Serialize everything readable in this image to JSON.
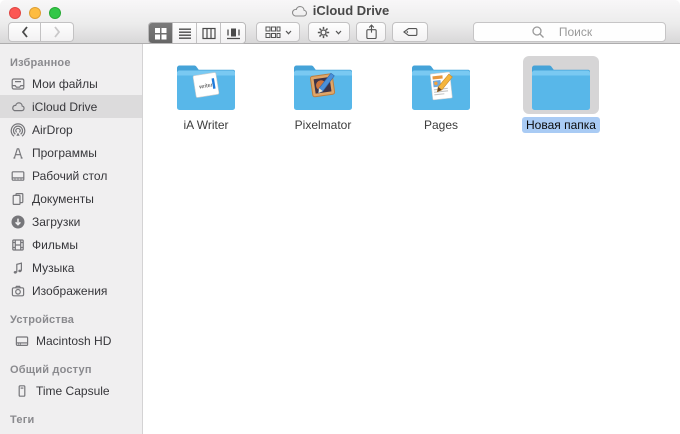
{
  "window": {
    "title": "iCloud Drive"
  },
  "toolbar": {
    "search_placeholder": "Поиск",
    "buttons": {
      "back": "back-button",
      "forward": "forward-button",
      "views": [
        "icons-view",
        "list-view",
        "columns-view",
        "coverflow-view"
      ],
      "selected_view": "icons-view"
    }
  },
  "sidebar": {
    "sections": [
      {
        "title": "Избранное",
        "items": [
          {
            "key": "my-files",
            "icon": "myfiles-icon",
            "label": "Мои файлы"
          },
          {
            "key": "icloud-drive",
            "icon": "icloud-icon",
            "label": "iCloud Drive",
            "selected": true
          },
          {
            "key": "airdrop",
            "icon": "airdrop-icon",
            "label": "AirDrop"
          },
          {
            "key": "applications",
            "icon": "applications-icon",
            "label": "Программы"
          },
          {
            "key": "desktop",
            "icon": "desktop-icon",
            "label": "Рабочий стол"
          },
          {
            "key": "documents",
            "icon": "documents-icon",
            "label": "Документы"
          },
          {
            "key": "downloads",
            "icon": "downloads-icon",
            "label": "Загрузки"
          },
          {
            "key": "movies",
            "icon": "movies-icon",
            "label": "Фильмы"
          },
          {
            "key": "music",
            "icon": "music-icon",
            "label": "Музыка"
          },
          {
            "key": "pictures",
            "icon": "pictures-icon",
            "label": "Изображения"
          }
        ]
      },
      {
        "title": "Устройства",
        "items": [
          {
            "key": "macintosh-hd",
            "icon": "harddrive-icon",
            "label": "Macintosh HD"
          }
        ]
      },
      {
        "title": "Общий доступ",
        "items": [
          {
            "key": "time-capsule",
            "icon": "timecapsule-icon",
            "label": "Time Capsule"
          }
        ]
      },
      {
        "title": "Теги",
        "items": []
      }
    ]
  },
  "main": {
    "items": [
      {
        "key": "ia-writer",
        "label": "iA Writer",
        "badge": "ia-writer",
        "selected": false
      },
      {
        "key": "pixelmator",
        "label": "Pixelmator",
        "badge": "pixelmator",
        "selected": false
      },
      {
        "key": "pages",
        "label": "Pages",
        "badge": "pages",
        "selected": false
      },
      {
        "key": "new-folder",
        "label": "Новая папка",
        "badge": "none",
        "selected": true
      }
    ]
  },
  "colors": {
    "folder_blue": "#58b7e9",
    "selection_label_blue": "#a9cbf4",
    "sidebar_selected_gray": "#dcdbdc",
    "icon_selected_gray": "#d6d5d6",
    "traffic_red": "#fc5753",
    "traffic_yellow": "#fdbc40",
    "traffic_green": "#33c748"
  }
}
